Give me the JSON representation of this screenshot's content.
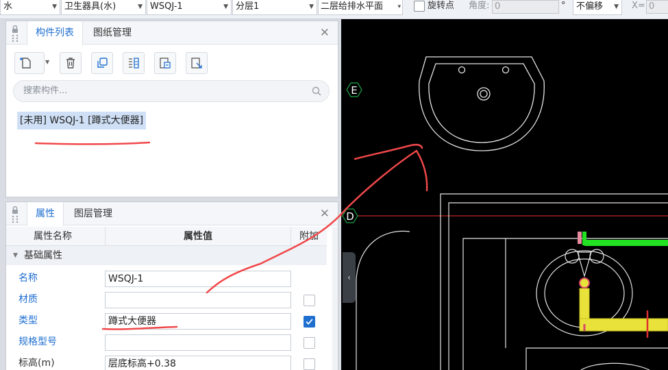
{
  "toolbar": {
    "combo_water": "水",
    "combo_category": "卫生器具(水)",
    "combo_component": "WSQJ-1",
    "combo_layer": "分层1",
    "combo_floor": "二层给排水平面",
    "rotate_label": "旋转点",
    "angle_label": "角度:",
    "angle_value": "0",
    "degree_symbol": "°",
    "offset_combo": "不偏移",
    "x_label": "X=",
    "x_value": "0"
  },
  "component_panel": {
    "tabs": [
      "构件列表",
      "图纸管理"
    ],
    "search_placeholder": "搜索构件...",
    "items": [
      "[未用] WSQJ-1 [蹲式大便器]"
    ],
    "icons": [
      "new-file-icon",
      "delete-icon",
      "copy-icon",
      "list-icon",
      "import-icon",
      "export-icon"
    ]
  },
  "property_panel": {
    "tabs": [
      "属性",
      "图层管理"
    ],
    "headers": {
      "name": "属性名称",
      "value": "属性值",
      "extra": "附加"
    },
    "group": "基础属性",
    "rows": [
      {
        "name": "名称",
        "value": "WSQJ-1",
        "extra": null
      },
      {
        "name": "材质",
        "value": "",
        "extra": false
      },
      {
        "name": "类型",
        "value": "蹲式大便器",
        "extra": true
      },
      {
        "name": "规格型号",
        "value": "",
        "extra": false
      },
      {
        "name": "标高(m)",
        "value": "层底标高+0.38",
        "extra": false
      }
    ]
  },
  "cad_view": {
    "axis_markers": [
      "E",
      "D"
    ],
    "colors": {
      "background": "#000000",
      "lines": "#ffffff",
      "axis": "#1fa84a",
      "red_line": "#c0282b",
      "pipe_green": "#22e022",
      "pipe_yellow": "#e8e23a"
    }
  },
  "annotations": {
    "stroke_color": "#f0484a"
  },
  "colors": {
    "accent": "#1f6fd0",
    "selected_bg": "#cfe0f6"
  }
}
